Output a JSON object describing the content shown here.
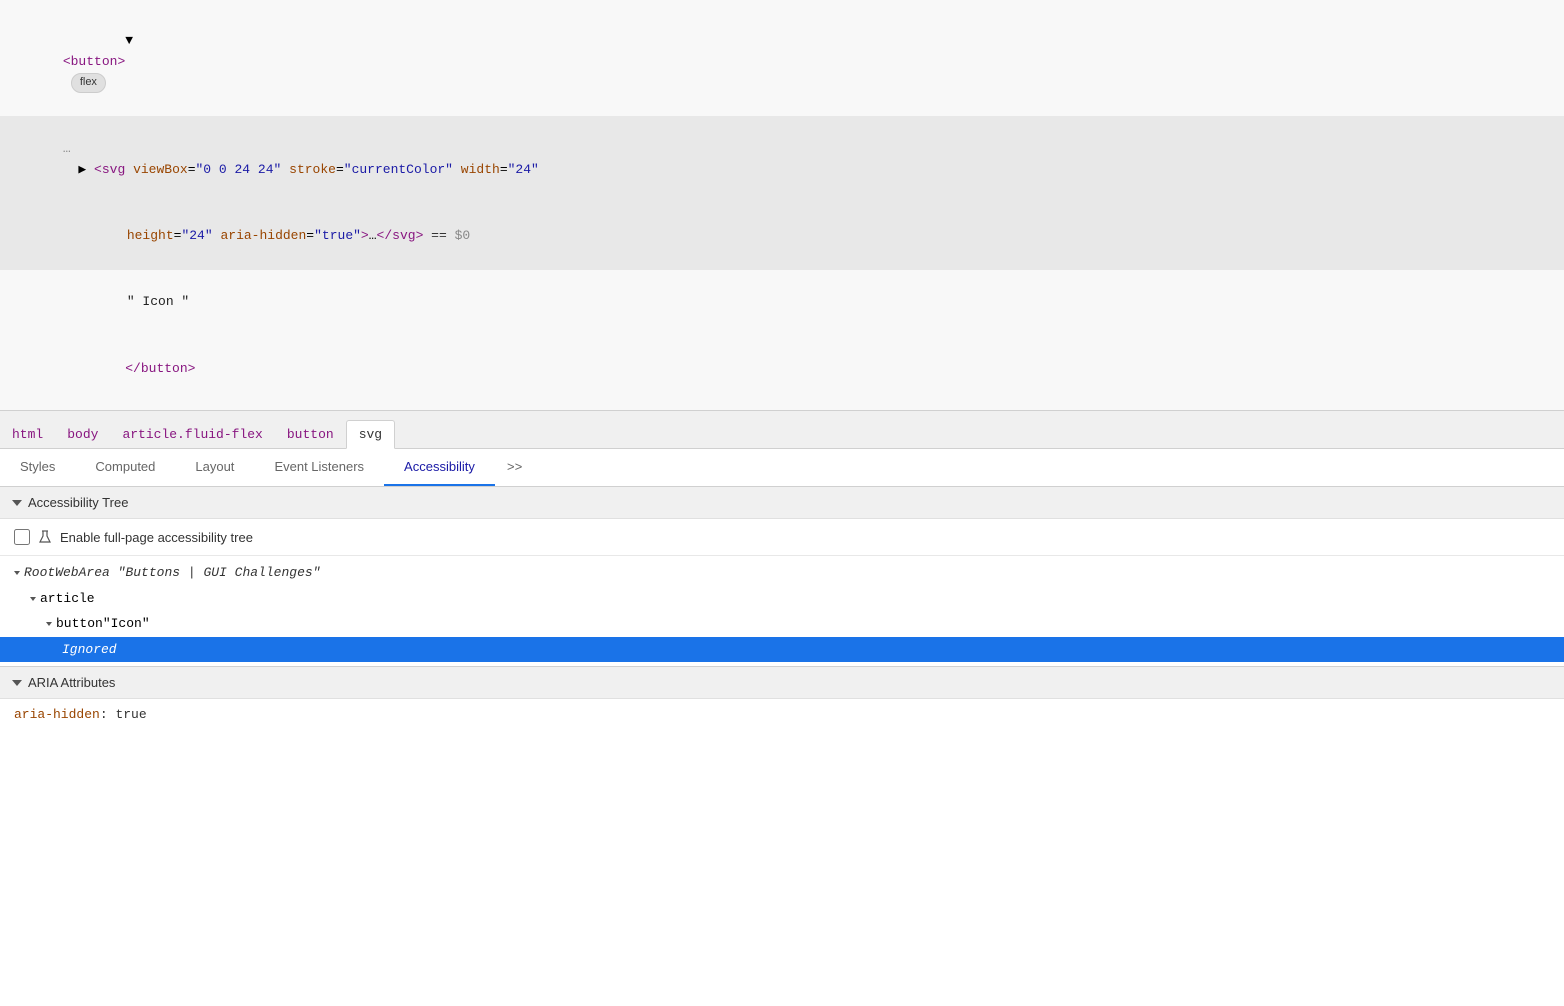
{
  "source": {
    "lines": [
      {
        "id": "line1",
        "indent": "        ▼",
        "content_parts": [
          {
            "type": "tag_bracket",
            "text": "<"
          },
          {
            "type": "tag_name",
            "text": "button"
          },
          {
            "type": "tag_bracket",
            "text": ">"
          }
        ],
        "badge": "flex",
        "highlighted": false
      },
      {
        "id": "line2",
        "dots": "…",
        "indent": "          ▶",
        "content_parts": [
          {
            "type": "tag_bracket",
            "text": "<"
          },
          {
            "type": "tag_name",
            "text": "svg"
          },
          {
            "type": "text",
            "text": " "
          },
          {
            "type": "attr_name",
            "text": "viewBox"
          },
          {
            "type": "text",
            "text": "="
          },
          {
            "type": "attr_value",
            "text": "\"0 0 24 24\""
          },
          {
            "type": "text",
            "text": " "
          },
          {
            "type": "attr_name",
            "text": "stroke"
          },
          {
            "type": "text",
            "text": "="
          },
          {
            "type": "attr_value",
            "text": "\"currentColor\""
          },
          {
            "type": "text",
            "text": " "
          },
          {
            "type": "attr_name",
            "text": "width"
          },
          {
            "type": "text",
            "text": "="
          },
          {
            "type": "attr_value",
            "text": "\"24\""
          }
        ],
        "highlighted": true
      },
      {
        "id": "line3",
        "indent": "          ",
        "content_parts": [
          {
            "type": "attr_name",
            "text": "height"
          },
          {
            "type": "text",
            "text": "="
          },
          {
            "type": "attr_value",
            "text": "\"24\""
          },
          {
            "type": "text",
            "text": " "
          },
          {
            "type": "attr_name",
            "text": "aria-hidden"
          },
          {
            "type": "text",
            "text": "="
          },
          {
            "type": "attr_value",
            "text": "\"true\""
          },
          {
            "type": "tag_bracket",
            "text": ">"
          },
          {
            "type": "text",
            "text": "…"
          },
          {
            "type": "tag_bracket",
            "text": "</"
          },
          {
            "type": "tag_name",
            "text": "svg"
          },
          {
            "type": "tag_bracket",
            "text": ">"
          },
          {
            "type": "text",
            "text": " == "
          },
          {
            "type": "dollar_zero",
            "text": "$0"
          }
        ],
        "highlighted": true
      },
      {
        "id": "line4",
        "indent": "          ",
        "content_parts": [
          {
            "type": "text",
            "text": "\" Icon \""
          }
        ],
        "highlighted": false
      },
      {
        "id": "line5",
        "indent": "        ",
        "content_parts": [
          {
            "type": "tag_bracket",
            "text": "</"
          },
          {
            "type": "tag_name",
            "text": "button"
          },
          {
            "type": "tag_bracket",
            "text": ">"
          }
        ],
        "highlighted": false
      }
    ]
  },
  "breadcrumb": {
    "items": [
      "html",
      "body",
      "article.fluid-flex",
      "button",
      "svg"
    ],
    "active_index": 4
  },
  "tabs": {
    "items": [
      "Styles",
      "Computed",
      "Layout",
      "Event Listeners",
      "Accessibility"
    ],
    "active_index": 4,
    "more_label": ">>"
  },
  "accessibility_tree": {
    "section_title": "Accessibility Tree",
    "enable_checkbox": {
      "label": "Enable full-page accessibility tree",
      "checked": false
    },
    "nodes": [
      {
        "id": "node1",
        "indent": 0,
        "type": "RootWebArea",
        "label": "\"Buttons | GUI Challenges\"",
        "has_chevron": true,
        "chevron_type": "down",
        "selected": false,
        "italic": true
      },
      {
        "id": "node2",
        "indent": 1,
        "type": "article",
        "label": "",
        "has_chevron": true,
        "chevron_type": "down",
        "selected": false,
        "italic": false
      },
      {
        "id": "node3",
        "indent": 2,
        "type": "button",
        "label": "\"Icon\"",
        "has_chevron": true,
        "chevron_type": "down",
        "selected": false,
        "italic": false,
        "label_italic": true
      },
      {
        "id": "node4",
        "indent": 3,
        "type": "Ignored",
        "label": "",
        "has_chevron": false,
        "selected": true,
        "italic": true
      }
    ]
  },
  "aria_attributes": {
    "section_title": "ARIA Attributes",
    "attributes": [
      {
        "key": "aria-hidden",
        "colon": ":",
        "value": "true"
      }
    ]
  }
}
